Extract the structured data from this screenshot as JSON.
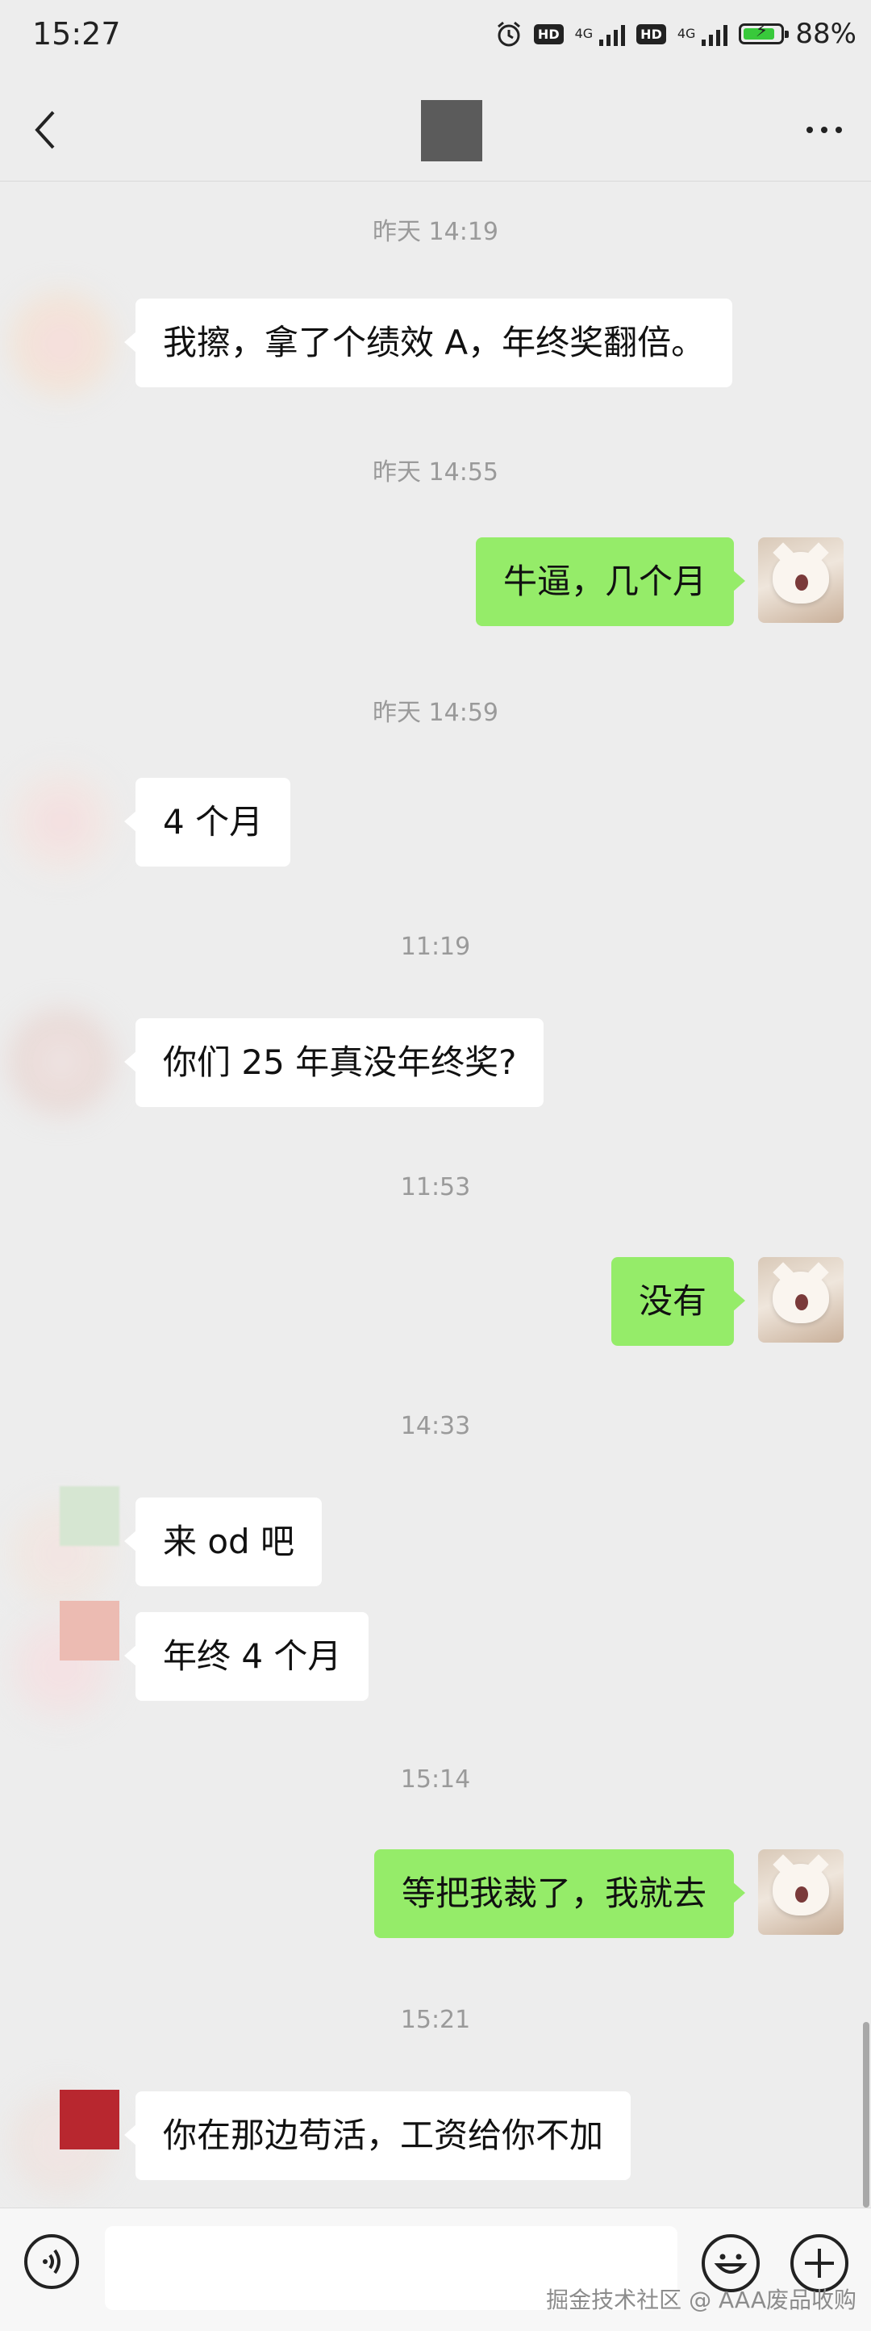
{
  "status_bar": {
    "time": "15:27",
    "net_label_1": "4G",
    "net_label_2": "4G",
    "hd_label": "HD",
    "battery": "88%",
    "battery_level": 0.88
  },
  "nav": {
    "back": "back",
    "more": "more"
  },
  "messages": [
    {
      "timestamp": "昨天 14:19",
      "from": "other",
      "text": "我擦，拿了个绩效 A，年终奖翻倍。"
    },
    {
      "timestamp": "昨天 14:55",
      "from": "me",
      "text": "牛逼，几个月"
    },
    {
      "timestamp": "昨天 14:59",
      "from": "other",
      "text": "4 个月"
    },
    {
      "timestamp": "11:19",
      "from": "other",
      "text": "你们 25 年真没年终奖?"
    },
    {
      "timestamp": "11:53",
      "from": "me",
      "text": "没有"
    },
    {
      "timestamp": "14:33",
      "from": "other",
      "text": "来 od 吧"
    },
    {
      "timestamp": "",
      "from": "other",
      "text": "年终 4 个月"
    },
    {
      "timestamp": "15:14",
      "from": "me",
      "text": "等把我裁了，我就去"
    },
    {
      "timestamp": "15:21",
      "from": "other",
      "text": "你在那边苟活，工资给你不加"
    }
  ],
  "input": {
    "value": "",
    "placeholder": ""
  },
  "watermark": "掘金技术社区 @ AAA废品收购",
  "colors": {
    "background": "#ededed",
    "bubble_me": "#95ec69",
    "bubble_other": "#ffffff",
    "battery_fill": "#38c93b"
  },
  "icons": [
    "alarm-icon",
    "signal-icon",
    "battery-icon",
    "back-arrow-icon",
    "more-dots-icon",
    "voice-icon",
    "emoji-icon",
    "plus-icon"
  ]
}
